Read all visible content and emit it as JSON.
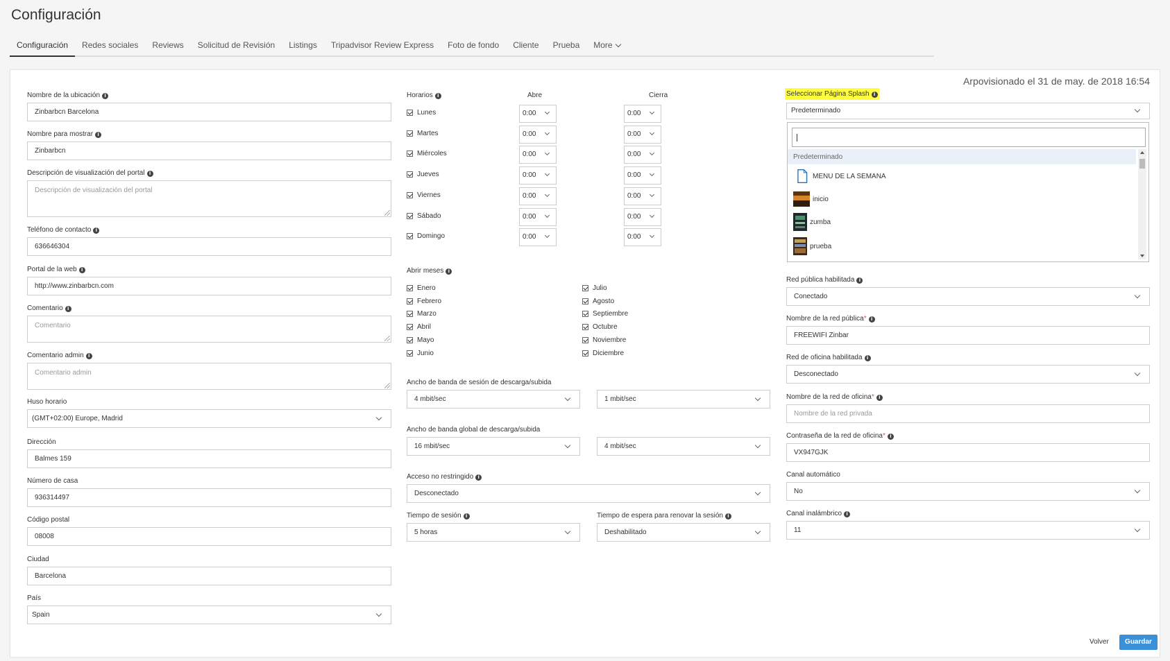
{
  "page": {
    "title": "Configuración"
  },
  "tabs": [
    "Configuración",
    "Redes sociales",
    "Reviews",
    "Solicitud de Revisión",
    "Listings",
    "Tripadvisor Review Express",
    "Foto de fondo",
    "Cliente",
    "Prueba",
    "More"
  ],
  "provision_text": "Arpovisionado el 31 de may. de 2018 16:54",
  "left": {
    "location_name": {
      "label": "Nombre de la ubicación",
      "value": "Zinbarbcn Barcelona"
    },
    "display_name": {
      "label": "Nombre para mostrar",
      "value": "Zinbarbcn"
    },
    "portal_description": {
      "label": "Descripción de visualización del portal",
      "placeholder": "Descripción de visualización del portal"
    },
    "phone": {
      "label": "Teléfono de contacto",
      "value": "636646304"
    },
    "web_portal": {
      "label": "Portal de la web",
      "value": "http://www.zinbarbcn.com"
    },
    "comment": {
      "label": "Comentario",
      "placeholder": "Comentario"
    },
    "admin_comment": {
      "label": "Comentario admin",
      "placeholder": "Comentario admin"
    },
    "timezone": {
      "label": "Huso horario",
      "value": "(GMT+02:00) Europe, Madrid"
    },
    "address": {
      "label": "Dirección",
      "value": "Balmes 159"
    },
    "house_number": {
      "label": "Número de casa",
      "value": "936314497"
    },
    "postal_code": {
      "label": "Código postal",
      "value": "08008"
    },
    "city": {
      "label": "Ciudad",
      "value": "Barcelona"
    },
    "country": {
      "label": "País",
      "value": "Spain"
    }
  },
  "middle": {
    "hours_label": "Horarios",
    "opens_label": "Abre",
    "closes_label": "Cierra",
    "days": [
      {
        "name": "Lunes",
        "open": "0:00",
        "close": "0:00"
      },
      {
        "name": "Martes",
        "open": "0:00",
        "close": "0:00"
      },
      {
        "name": "Miércoles",
        "open": "0:00",
        "close": "0:00"
      },
      {
        "name": "Jueves",
        "open": "0:00",
        "close": "0:00"
      },
      {
        "name": "Viernes",
        "open": "0:00",
        "close": "0:00"
      },
      {
        "name": "Sábado",
        "open": "0:00",
        "close": "0:00"
      },
      {
        "name": "Domingo",
        "open": "0:00",
        "close": "0:00"
      }
    ],
    "months_label": "Abrir meses",
    "months_left": [
      "Enero",
      "Febrero",
      "Marzo",
      "Abril",
      "Mayo",
      "Junio"
    ],
    "months_right": [
      "Julio",
      "Agosto",
      "Septiembre",
      "Octubre",
      "Noviembre",
      "Diciembre"
    ],
    "session_bw": {
      "label": "Ancho de banda de sesión de descarga/subida",
      "down": "4 mbit/sec",
      "up": "1 mbit/sec"
    },
    "global_bw": {
      "label": "Ancho de banda global de descarga/subida",
      "down": "16 mbit/sec",
      "up": "4 mbit/sec"
    },
    "unrestricted": {
      "label": "Acceso no restringido",
      "value": "Desconectado"
    },
    "session_time": {
      "label": "Tiempo de sesión",
      "value": "5 horas"
    },
    "renew_wait": {
      "label": "Tiempo de espera para renovar la sesión",
      "value": "Deshabilitado"
    }
  },
  "right": {
    "splash": {
      "label": "Seleccionar Página Splash",
      "value": "Predeterminado"
    },
    "dropdown_options": [
      "Predeterminado",
      "MENU DE LA SEMANA",
      "inicio",
      "zumba",
      "prueba"
    ],
    "public_net_enabled": {
      "label": "Red pública habilitada",
      "value": "Conectado"
    },
    "public_net_name": {
      "label": "Nombre de la red pública",
      "value": "FREEWIFI Zinbar"
    },
    "office_net_enabled": {
      "label": "Red de oficina habilitada",
      "value": "Desconectado"
    },
    "office_net_name": {
      "label": "Nombre de la red de oficina",
      "placeholder": "Nombre de la red privada"
    },
    "office_password": {
      "label": "Contraseña de la red de oficina",
      "value": "VX947GJK"
    },
    "auto_channel": {
      "label": "Canal automático",
      "value": "No"
    },
    "wireless_channel": {
      "label": "Canal inalámbrico",
      "value": "11"
    }
  },
  "buttons": {
    "back": "Volver",
    "save": "Guardar"
  },
  "colors": {
    "primary": "#3a8fd9",
    "highlight": "#ffff3d"
  }
}
